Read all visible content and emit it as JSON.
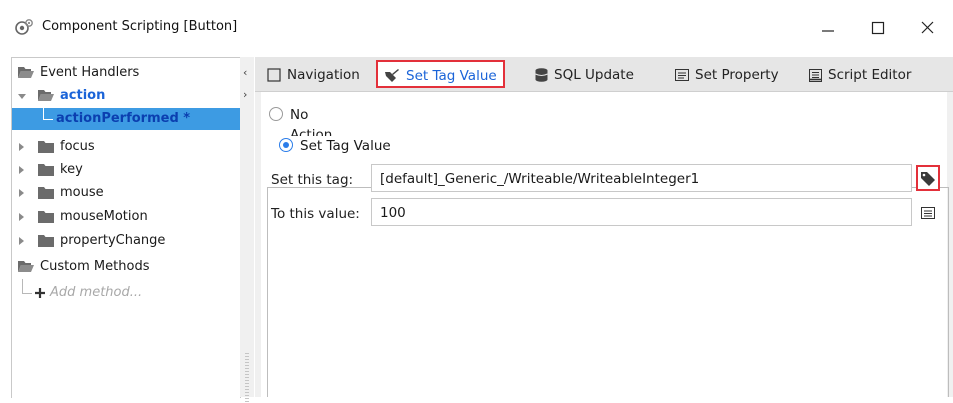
{
  "window": {
    "title": "Component Scripting [Button]",
    "controls": {
      "minimize": "minimize-icon",
      "maximize": "maximize-icon",
      "close": "close-icon"
    }
  },
  "tree": {
    "event_handlers_label": "Event Handlers",
    "items": [
      {
        "label": "action",
        "expanded": true,
        "bold": true
      },
      {
        "label": "actionPerformed *",
        "selected": true
      },
      {
        "label": "focus"
      },
      {
        "label": "key"
      },
      {
        "label": "mouse"
      },
      {
        "label": "mouseMotion"
      },
      {
        "label": "propertyChange"
      }
    ],
    "custom_methods_label": "Custom Methods",
    "add_method_label": "Add method..."
  },
  "tabs": [
    {
      "label": "Navigation",
      "icon": "navigation-icon"
    },
    {
      "label": "Set Tag Value",
      "icon": "tag-pencil-icon",
      "active": true
    },
    {
      "label": "SQL Update",
      "icon": "database-icon"
    },
    {
      "label": "Set Property",
      "icon": "property-icon"
    },
    {
      "label": "Script Editor",
      "icon": "script-icon"
    }
  ],
  "action": {
    "no_action_label": "No Action",
    "set_tag_value_label": "Set Tag Value",
    "selected": "Set Tag Value"
  },
  "form": {
    "tag_label": "Set this tag:",
    "tag_value": "[default]_Generic_/Writeable/WriteableInteger1",
    "value_label": "To this value:",
    "value": "100"
  },
  "colors": {
    "accent": "#1b64d8",
    "highlight": "#e3303a",
    "selection": "#3d9be3"
  }
}
